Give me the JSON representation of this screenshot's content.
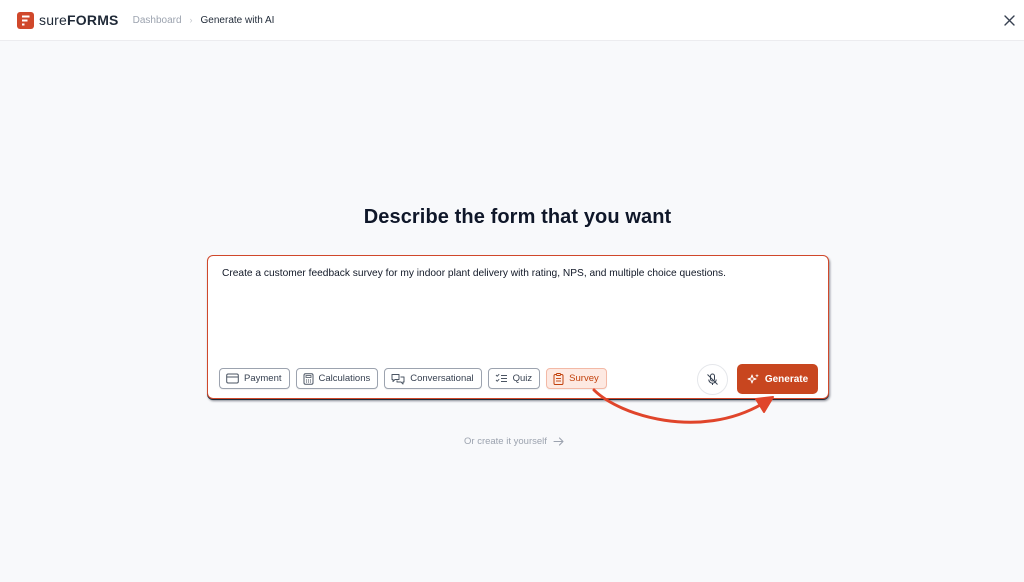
{
  "brand": {
    "name_light": "sure",
    "name_bold": "FORMS"
  },
  "breadcrumb": {
    "parent": "Dashboard",
    "current": "Generate with AI"
  },
  "heading": "Describe the form that you want",
  "prompt": {
    "value": "Create a customer feedback survey for my indoor plant delivery with rating, NPS, and multiple choice questions."
  },
  "chips": [
    {
      "label": "Payment",
      "icon": "credit-card-icon",
      "active": false
    },
    {
      "label": "Calculations",
      "icon": "calculator-icon",
      "active": false
    },
    {
      "label": "Conversational",
      "icon": "chat-bubbles-icon",
      "active": false
    },
    {
      "label": "Quiz",
      "icon": "checklist-icon",
      "active": false
    },
    {
      "label": "Survey",
      "icon": "clipboard-icon",
      "active": true
    }
  ],
  "generate_label": "Generate",
  "alt_link": "Or create it yourself",
  "colors": {
    "accent": "#c8461f",
    "annotation_arrow": "#e0452b",
    "chip_active_bg": "#fde9e2"
  }
}
